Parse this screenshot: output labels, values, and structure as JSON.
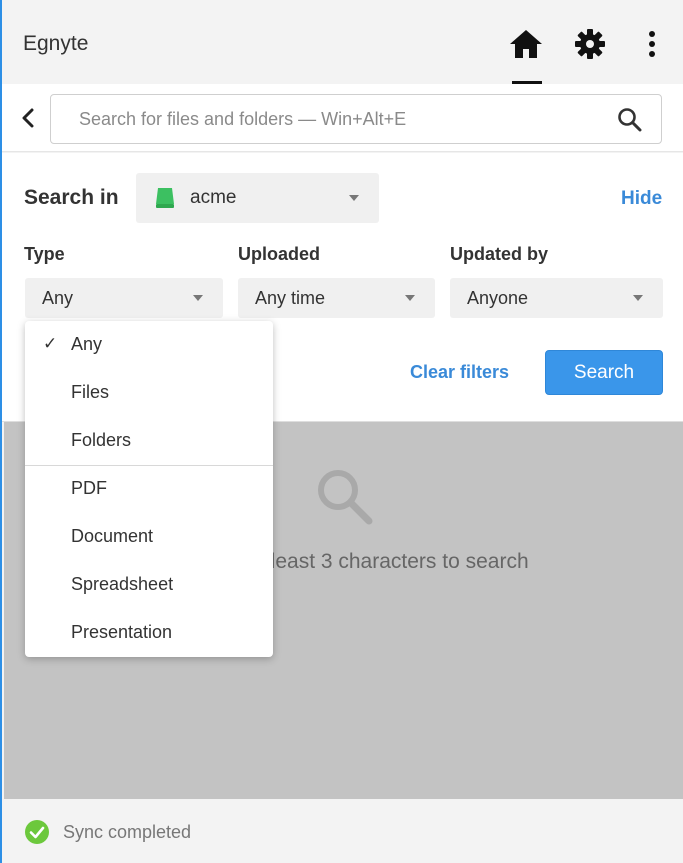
{
  "app": {
    "title": "Egnyte"
  },
  "search": {
    "placeholder": "Search for files and folders — Win+Alt+E",
    "value": ""
  },
  "filters": {
    "search_in_label": "Search in",
    "location_value": "acme",
    "hide_label": "Hide",
    "type_label": "Type",
    "type_value": "Any",
    "uploaded_label": "Uploaded",
    "uploaded_value": "Any time",
    "updated_by_label": "Updated by",
    "updated_by_value": "Anyone",
    "clear_label": "Clear filters",
    "search_button_label": "Search"
  },
  "type_dropdown": {
    "selected": "Any",
    "options": [
      "Any",
      "Files",
      "Folders",
      "PDF",
      "Document",
      "Spreadsheet",
      "Presentation"
    ]
  },
  "results": {
    "empty_message": "t least 3 characters to search"
  },
  "status": {
    "text": "Sync completed"
  },
  "colors": {
    "accent": "#3a96ea",
    "link": "#3a8ad8",
    "drive_green": "#3cc061",
    "sync_green": "#6cc83c"
  },
  "icons": {
    "home": "home-icon",
    "settings": "gear-icon",
    "more": "more-vertical-icon",
    "back": "chevron-left-icon",
    "search": "search-icon",
    "drive": "drive-icon",
    "check": "check-icon",
    "status": "check-circle-icon"
  }
}
